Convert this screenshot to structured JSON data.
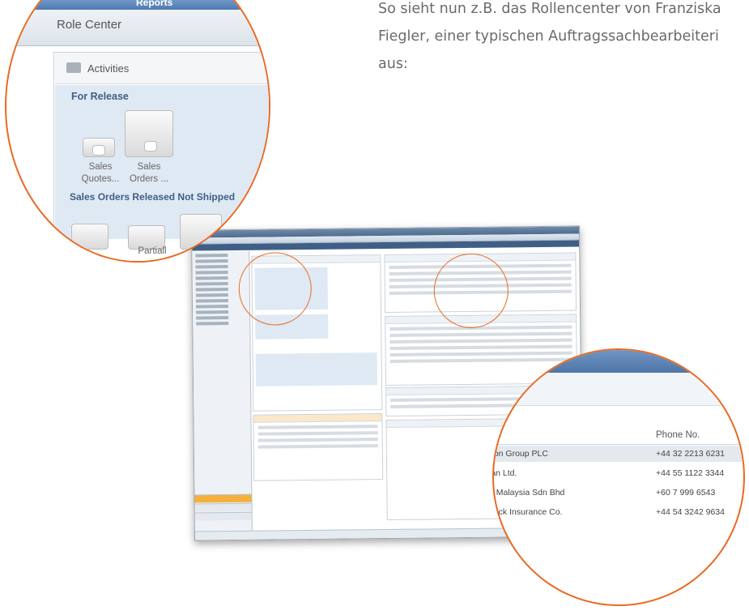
{
  "caption": {
    "line1": "So sieht nun z.B. das Rollencenter von Franziska",
    "line2": "Fiegler, einer typischen Auftragssachbearbeiteri",
    "line3": "aus:"
  },
  "zoom_left": {
    "reports_label": "Reports",
    "role_center_title": "Role Center",
    "activities_label": "Activities",
    "for_release_label": "For Release",
    "tiles": [
      {
        "label": "Sales Quotes..."
      },
      {
        "label": "Sales Orders ..."
      }
    ],
    "section2_label": "Sales Orders Released Not Shipped",
    "partial_label": "Partiall"
  },
  "zoom_right": {
    "column_header": "Phone No.",
    "rows": [
      {
        "name": "non Group PLC",
        "phone": "+44 32 2213 6231"
      },
      {
        "name": "ian Ltd.",
        "phone": "+44 55 1122 3344"
      },
      {
        "name": "d Malaysia Sdn Bhd",
        "phone": "+60 7 999 6543"
      },
      {
        "name": "dock Insurance Co.",
        "phone": "+44 54 3242 9634"
      }
    ]
  },
  "colors": {
    "accent": "#e86a24",
    "cue_blue": "#dfe9f3",
    "title_blue": "#3f5f86"
  }
}
